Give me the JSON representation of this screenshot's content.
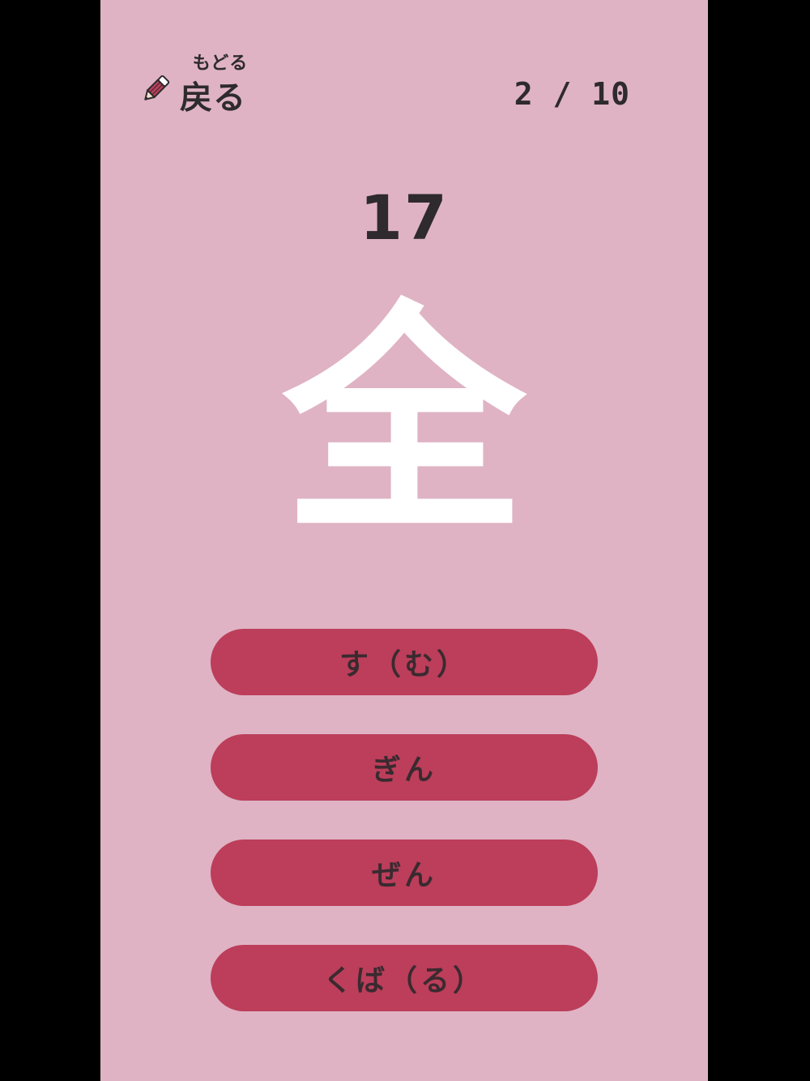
{
  "header": {
    "back_ruby": "もどる",
    "back_label": "戻る",
    "progress": "2 / 10"
  },
  "question": {
    "stroke_count": "17",
    "kanji": "全"
  },
  "answers": [
    {
      "label": "す（む）"
    },
    {
      "label": "ぎん"
    },
    {
      "label": "ぜん"
    },
    {
      "label": "くば（る）"
    }
  ],
  "colors": {
    "background": "#dfb3c4",
    "button": "#bc3e5a",
    "text": "#2e2a2e",
    "kanji": "#ffffff"
  },
  "icons": {
    "back": "pencil-icon"
  }
}
